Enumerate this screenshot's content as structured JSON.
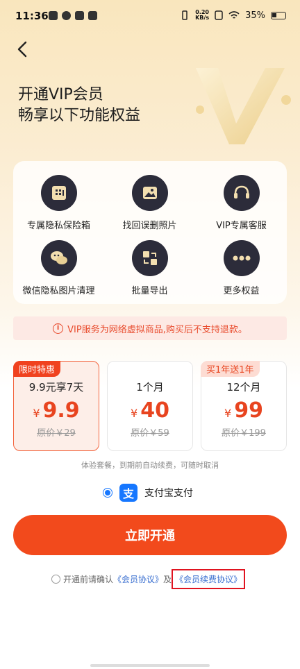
{
  "status_bar": {
    "time": "11:36",
    "net_speed": "0.20\nKB/s",
    "battery": "35%"
  },
  "header": {
    "title_line1": "开通VIP会员",
    "title_line2": "畅享以下功能权益"
  },
  "features": [
    {
      "label": "专属隐私保险箱",
      "icon": "safe-icon"
    },
    {
      "label": "找回误删照片",
      "icon": "photo-icon"
    },
    {
      "label": "VIP专属客服",
      "icon": "headset-icon"
    },
    {
      "label": "微信隐私图片清理",
      "icon": "chat-icon"
    },
    {
      "label": "批量导出",
      "icon": "export-icon"
    },
    {
      "label": "更多权益",
      "icon": "more-icon"
    }
  ],
  "notice": {
    "icon": "i",
    "text": "VIP服务为网络虚拟商品,购买后不支持退款。"
  },
  "plans": [
    {
      "badge": "限时特惠",
      "name": "9.9元享7天",
      "currency": "¥",
      "price": "9.9",
      "original": "原价￥29"
    },
    {
      "badge": "",
      "name": "1个月",
      "currency": "¥",
      "price": "40",
      "original": "原价￥59"
    },
    {
      "badge": "买1年送1年",
      "name": "12个月",
      "currency": "¥",
      "price": "99",
      "original": "原价￥199"
    }
  ],
  "renew_note": "体验套餐，到期前自动续费，可随时取消",
  "payment": {
    "icon": "支",
    "label": "支付宝支付"
  },
  "cta": {
    "label": "立即开通"
  },
  "agreement": {
    "prefix": "开通前请确认",
    "link1": "《会员协议》",
    "joiner": "及",
    "link2": "《会员续费协议》"
  },
  "colors": {
    "accent": "#f24a1c",
    "link": "#3a6fd0",
    "icon_bg": "#2c2c3a",
    "highlight": "#e0131f"
  }
}
